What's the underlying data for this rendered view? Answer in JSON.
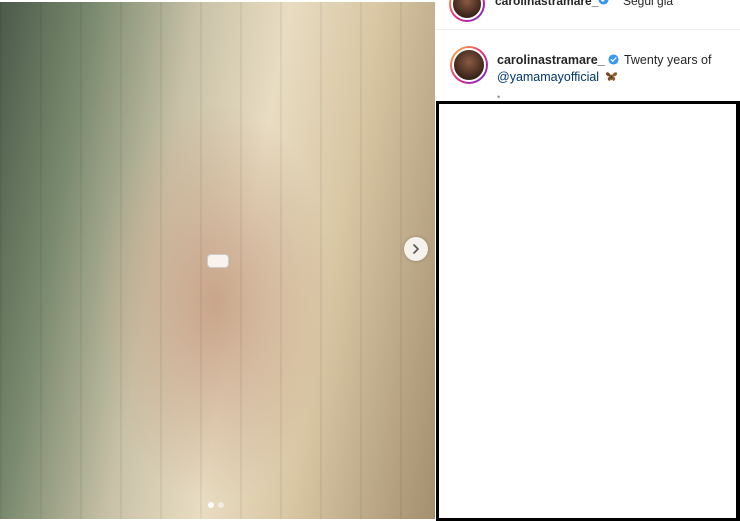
{
  "post": {
    "media": {
      "placeholder_label": "",
      "carousel_total": 2,
      "carousel_active": 1
    },
    "header": {
      "username": "carolinastramare_",
      "follow_label": "Segui già",
      "more_label": "•••",
      "verified_icon": "verified-badge-icon"
    },
    "caption": {
      "username": "carolinastramare_",
      "text_before": " Twenty years of ",
      "mention": "@yamamayofficial",
      "emoji_icon": "butterfly-icon",
      "faded_text": "•"
    }
  },
  "colors": {
    "verified": "#3897f0",
    "mention": "#00376b",
    "butterfly": "#7a4a1f",
    "popup_border": "#000000"
  }
}
